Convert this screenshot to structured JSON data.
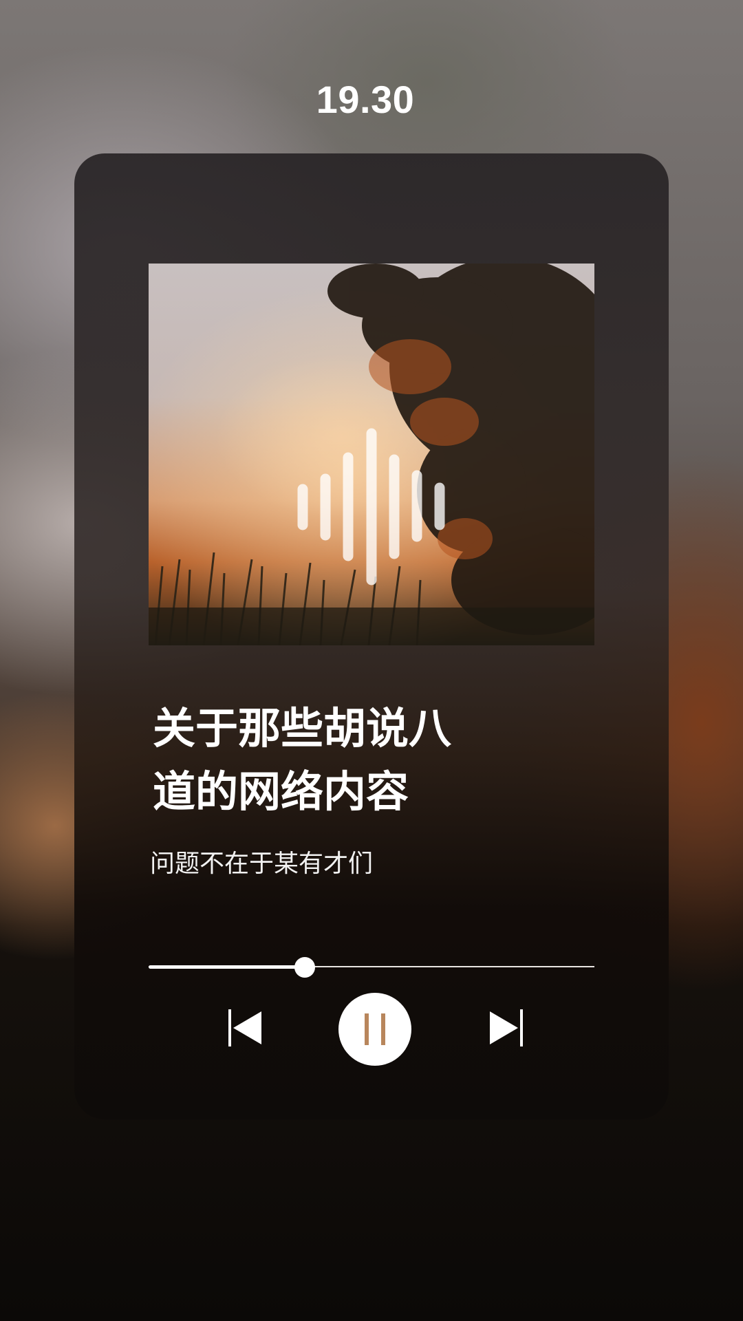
{
  "status": {
    "time": "19.30"
  },
  "player": {
    "album_art": {
      "description_icon": "audio-waveform-icon"
    },
    "track": {
      "title": "关于那些胡说八道的网络内容",
      "artist": "问题不在于某有才们"
    },
    "progress": {
      "fraction": 0.35
    },
    "controls": {
      "previous_icon": "skip-previous-icon",
      "play_pause_icon": "pause-icon",
      "next_icon": "skip-next-icon"
    }
  },
  "colors": {
    "accent": "#b8865c",
    "foreground": "#ffffff"
  }
}
